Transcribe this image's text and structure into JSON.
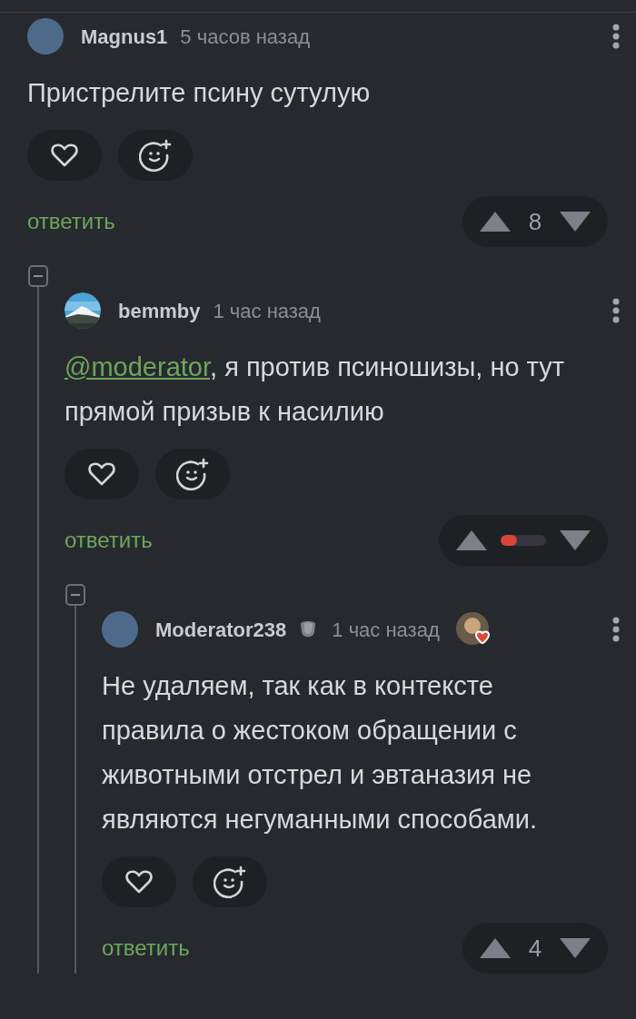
{
  "comments": [
    {
      "author": "Magnus1",
      "time": "5 часов назад",
      "avatar": {
        "kind": "plain"
      },
      "text": "Пристрелите псину сутулую",
      "reply_label": "ответить",
      "rating": {
        "kind": "count",
        "value": "8"
      },
      "expanded": true,
      "children": [
        {
          "author": "bemmby",
          "time": "1 час назад",
          "mention": "@moderator",
          "text": ", я против псиношизы, но тут прямой призыв к насилию",
          "reply_label": "ответить",
          "rating": {
            "kind": "bar",
            "level": 0.35
          },
          "expanded": true,
          "children": [
            {
              "author": "Moderator238",
              "moderator_badge": true,
              "award": true,
              "time": "1 час назад",
              "avatar": {
                "kind": "plain"
              },
              "text": "Не удаляем, так как в контексте правила о жестоком обращении с животными отстрел и эвтаназия не являются негуманными способами.",
              "reply_label": "ответить",
              "rating": {
                "kind": "count",
                "value": "4"
              }
            }
          ]
        }
      ]
    }
  ]
}
